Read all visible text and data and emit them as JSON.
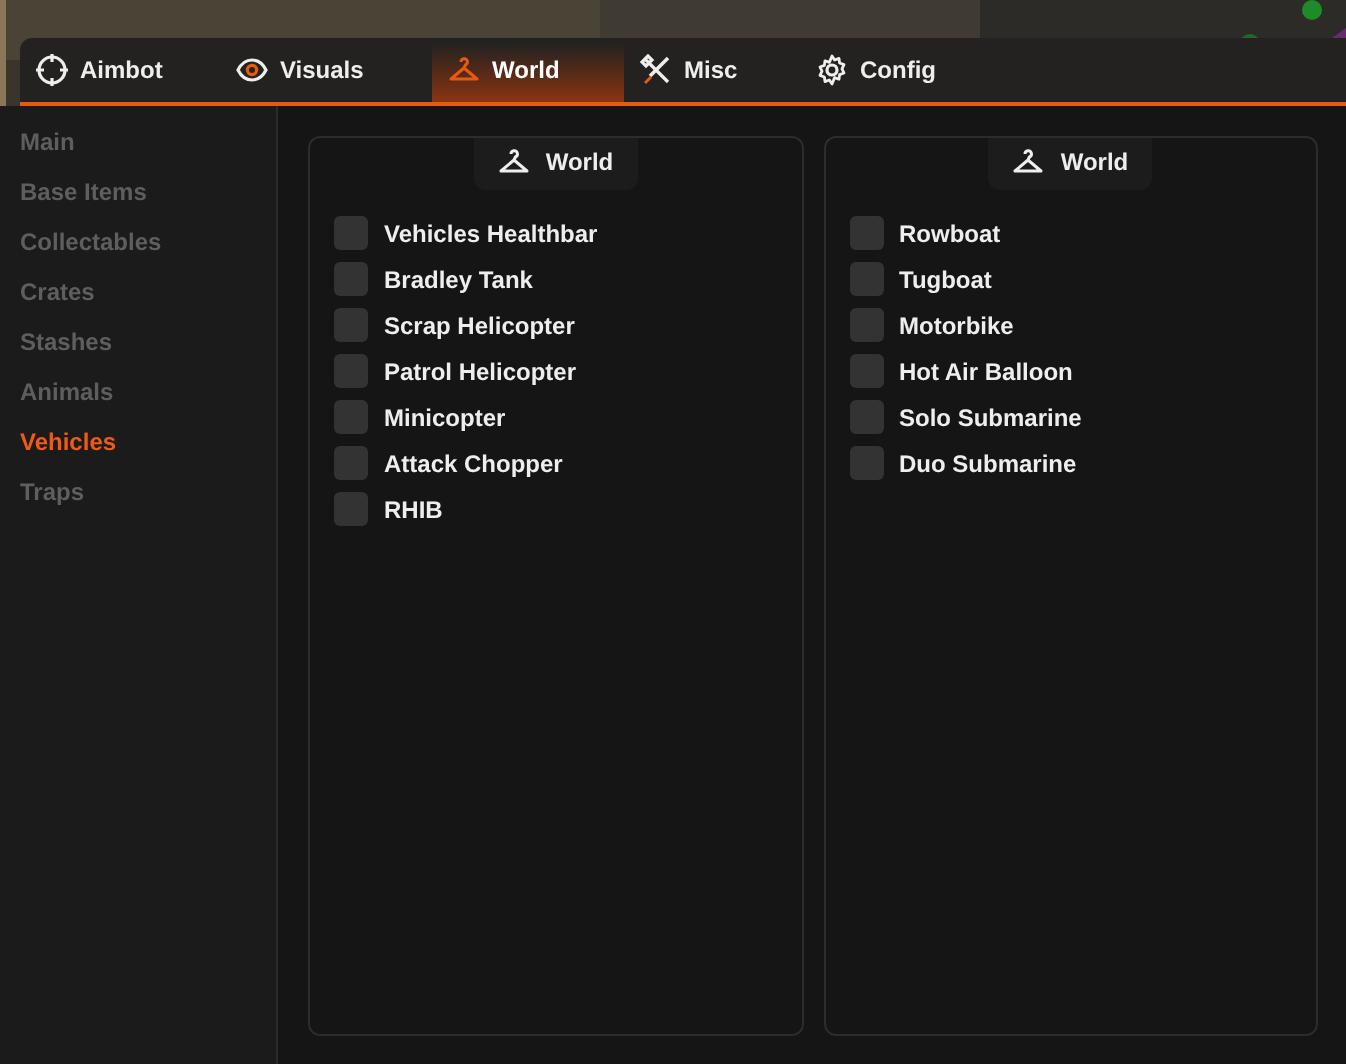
{
  "tabs": [
    {
      "label": "Aimbot",
      "kind": "crosshair",
      "selected": false
    },
    {
      "label": "Visuals",
      "kind": "eye",
      "selected": false
    },
    {
      "label": "World",
      "kind": "hanger",
      "selected": true
    },
    {
      "label": "Misc",
      "kind": "tools",
      "selected": false
    },
    {
      "label": "Config",
      "kind": "gear",
      "selected": false
    }
  ],
  "sidebar": {
    "items": [
      {
        "label": "Main",
        "selected": false
      },
      {
        "label": "Base Items",
        "selected": false
      },
      {
        "label": "Collectables",
        "selected": false
      },
      {
        "label": "Crates",
        "selected": false
      },
      {
        "label": "Stashes",
        "selected": false
      },
      {
        "label": "Animals",
        "selected": false
      },
      {
        "label": "Vehicles",
        "selected": true
      },
      {
        "label": "Traps",
        "selected": false
      }
    ]
  },
  "panels": [
    {
      "title": "World",
      "options": [
        {
          "label": "Vehicles Healthbar",
          "checked": false
        },
        {
          "label": "Bradley Tank",
          "checked": false
        },
        {
          "label": "Scrap Helicopter",
          "checked": false
        },
        {
          "label": "Patrol Helicopter",
          "checked": false
        },
        {
          "label": "Minicopter",
          "checked": false
        },
        {
          "label": "Attack Chopper",
          "checked": false
        },
        {
          "label": "RHIB",
          "checked": false
        }
      ]
    },
    {
      "title": "World",
      "options": [
        {
          "label": "Rowboat",
          "checked": false
        },
        {
          "label": "Tugboat",
          "checked": false
        },
        {
          "label": "Motorbike",
          "checked": false
        },
        {
          "label": "Hot Air Balloon",
          "checked": false
        },
        {
          "label": "Solo Submarine",
          "checked": false
        },
        {
          "label": "Duo Submarine",
          "checked": false
        }
      ]
    }
  ]
}
